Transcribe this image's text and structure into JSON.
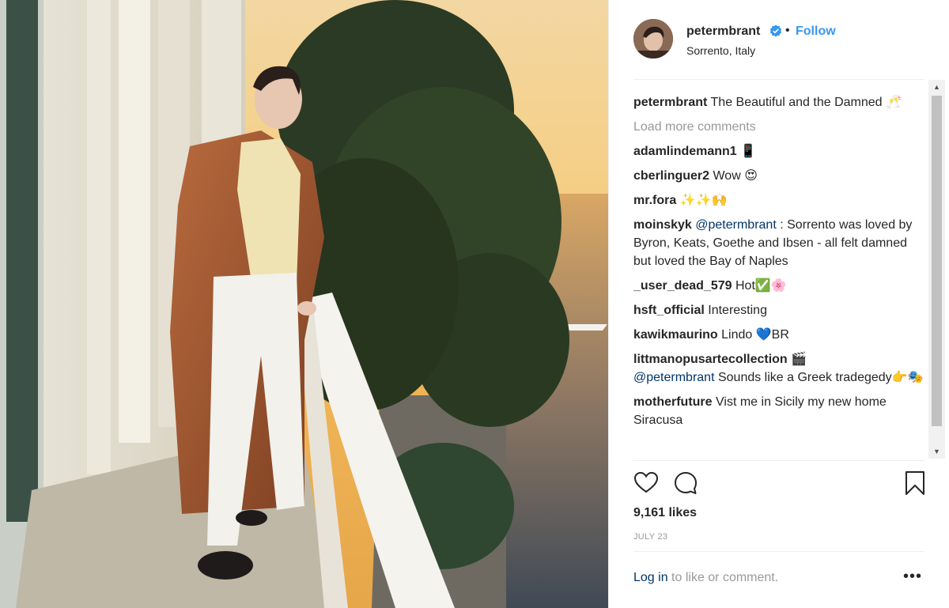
{
  "post": {
    "username": "petermbrant",
    "follow_label": "Follow",
    "separator": "•",
    "location": "Sorrento, Italy",
    "caption_text": "The Beautiful and the Damned 🥂",
    "load_more": "Load more comments",
    "likes": "9,161 likes",
    "date": "JULY 23",
    "login_link": "Log in",
    "login_suffix": " to like or comment.",
    "more_label": "•••"
  },
  "comments": [
    {
      "user": "adamlindemann1",
      "text": "📱",
      "mention": ""
    },
    {
      "user": "cberlinguer2",
      "text": "Wow 😍",
      "mention": ""
    },
    {
      "user": "mr.fora",
      "text": "✨✨🙌",
      "mention": ""
    },
    {
      "user": "moinskyk",
      "mention": "@petermbrant",
      "text": ": Sorrento was loved by Byron, Keats, Goethe and Ibsen - all felt damned but loved the Bay of Naples"
    },
    {
      "user": "_user_dead_579",
      "text": "Hot✅🌸",
      "mention": ""
    },
    {
      "user": "hsft_official",
      "text": "Interesting",
      "mention": ""
    },
    {
      "user": "kawikmaurino",
      "text": "Lindo 💙BR",
      "mention": ""
    },
    {
      "user": "littmanopusartecollection",
      "mention": "@petermbrant",
      "text": "Sounds like a Greek tradegedy👉🎭",
      "prefix": "🎬"
    },
    {
      "user": "motherfuture",
      "text": "Vist me in Sicily my new home Siracusa",
      "mention": ""
    }
  ],
  "icons": {
    "verified": "verified-badge-icon",
    "heart": "heart-icon",
    "comment": "comment-icon",
    "bookmark": "bookmark-icon"
  },
  "colors": {
    "accent": "#3897f0",
    "link": "#003569",
    "muted": "#999999"
  }
}
